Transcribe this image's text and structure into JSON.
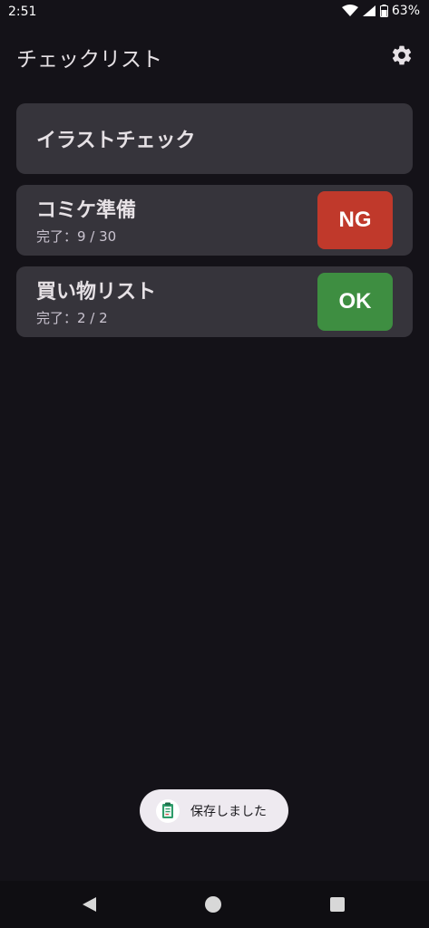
{
  "status": {
    "time": "2:51",
    "battery": "63%"
  },
  "app": {
    "title": "チェックリスト"
  },
  "lists": [
    {
      "title": "イラストチェック"
    },
    {
      "title": "コミケ準備",
      "progress": "完了：9 / 30",
      "status": "NG"
    },
    {
      "title": "買い物リスト",
      "progress": "完了：2 / 2",
      "status": "OK"
    }
  ],
  "toast": {
    "message": "保存しました"
  },
  "colors": {
    "ng": "#c0392b",
    "ok": "#3e8e41",
    "background": "#141218",
    "card": "#36343b"
  }
}
